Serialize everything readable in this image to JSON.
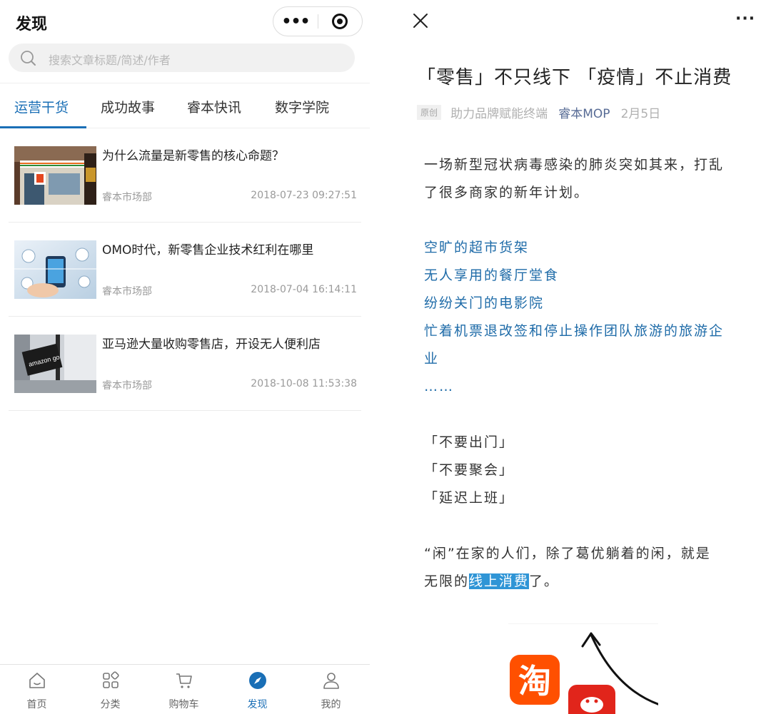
{
  "left": {
    "header": {
      "title": "发现"
    },
    "search": {
      "placeholder": "搜索文章标题/简述/作者"
    },
    "tabs": [
      {
        "label": "运营干货",
        "active": true
      },
      {
        "label": "成功故事",
        "active": false
      },
      {
        "label": "睿本快讯",
        "active": false
      },
      {
        "label": "数字学院",
        "active": false
      }
    ],
    "articles": [
      {
        "title": "为什么流量是新零售的核心命题？",
        "author": "睿本市场部",
        "date": "2018-07-23 09:27:51",
        "thumb": "store-photo"
      },
      {
        "title": "OMO时代，新零售企业技术红利在哪里",
        "author": "睿本市场部",
        "date": "2018-07-04 16:14:11",
        "thumb": "tech-photo"
      },
      {
        "title": "亚马逊大量收购零售店，开设无人便利店",
        "author": "睿本市场部",
        "date": "2018-10-08 11:53:38",
        "thumb": "amazon-photo",
        "thumb_text": "amazon go"
      }
    ],
    "tabbar": [
      {
        "label": "首页",
        "icon": "home-icon",
        "active": false
      },
      {
        "label": "分类",
        "icon": "category-icon",
        "active": false
      },
      {
        "label": "购物车",
        "icon": "cart-icon",
        "active": false
      },
      {
        "label": "发现",
        "icon": "compass-icon",
        "active": true
      },
      {
        "label": "我的",
        "icon": "user-icon",
        "active": false
      }
    ]
  },
  "right": {
    "title": "「零售」不只线下 「疫情」不止消费",
    "meta": {
      "badge": "原创",
      "source": "助力品牌赋能终端",
      "author": "睿本MOP",
      "date": "2月5日"
    },
    "intro": [
      "一场新型冠状病毒感染的肺炎突如其来，打乱",
      "了很多商家的新年计划。"
    ],
    "list": [
      "空旷的超市货架",
      "无人享用的餐厅堂食",
      "纷纷关门的电影院",
      "忙着机票退改签和停止操作团队旅游的旅游企",
      "业",
      "……"
    ],
    "quotes": [
      "「不要出门」",
      "「不要聚会」",
      "「延迟上班」"
    ],
    "closing": {
      "line1": "“闲”在家的人们，除了葛优躺着的闲，就是",
      "line2_pre": "无限的",
      "line2_hl": "线上消费",
      "line2_post": "了。"
    },
    "promo": {
      "taobao_char": "淘"
    }
  },
  "colors": {
    "accent": "#1a6fb6",
    "link": "#1e6ba8",
    "highlight": "#2f95d6",
    "taobao": "#ff5000",
    "jd": "#e1251b"
  }
}
